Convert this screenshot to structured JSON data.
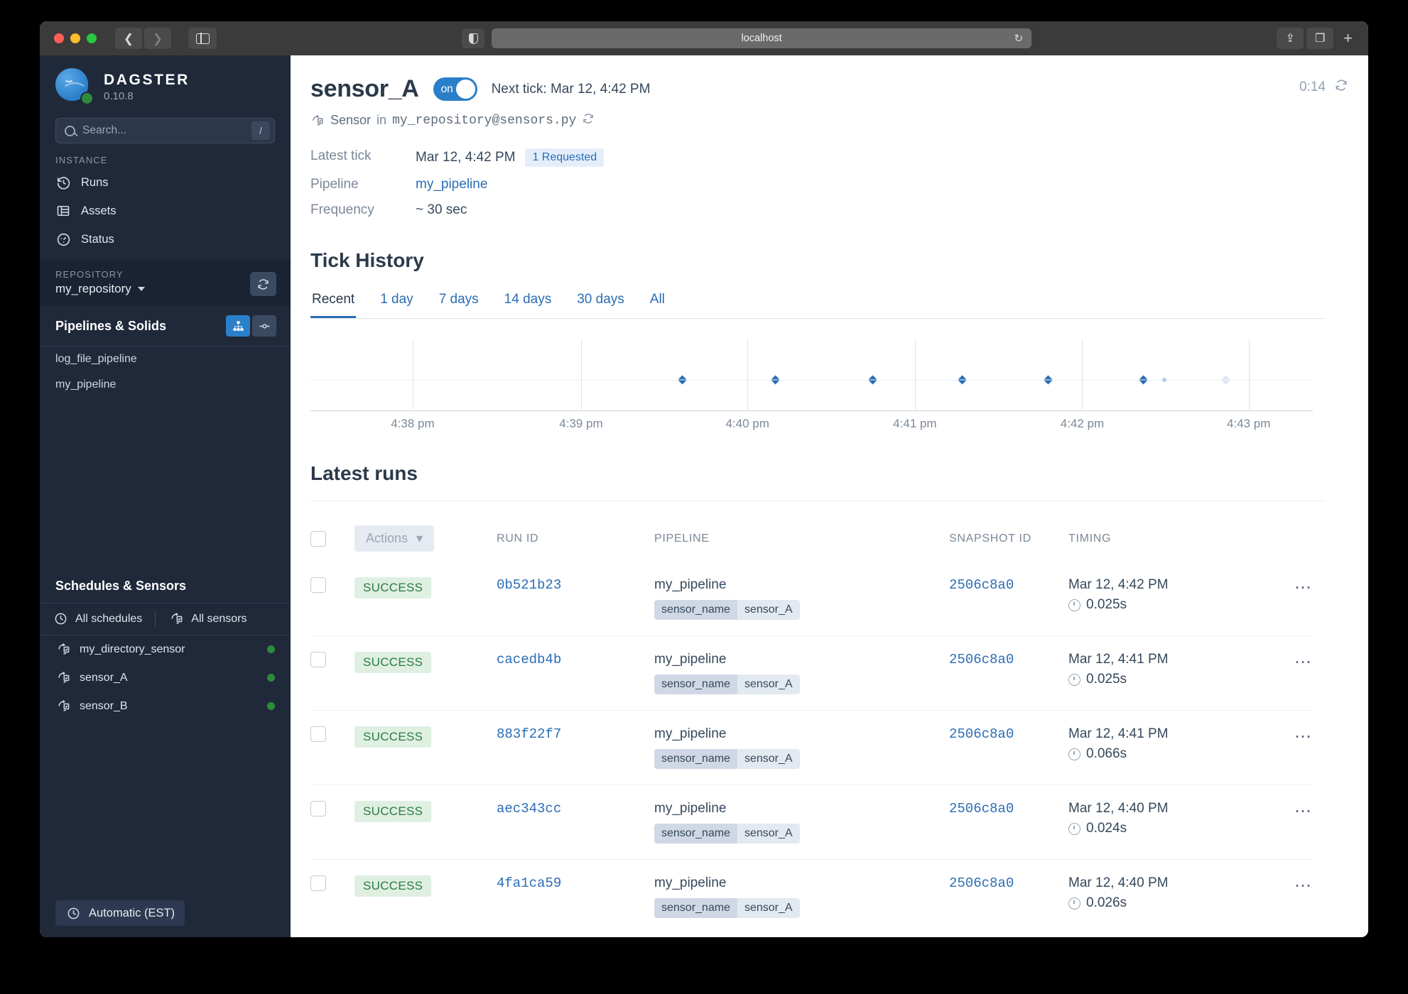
{
  "browser": {
    "url": "localhost",
    "back_icon": "chevron-left-icon",
    "forward_icon": "chevron-right-icon",
    "sidebar_icon": "sidebar-toggle-icon",
    "shield_icon": "reader-contrast-icon",
    "reload_icon": "reload-icon",
    "share_icon": "share-icon",
    "tabs_icon": "tab-overview-icon",
    "new_tab_icon": "plus-icon"
  },
  "sidebar": {
    "brand": {
      "name": "DAGSTER",
      "version": "0.10.8"
    },
    "search": {
      "placeholder": "Search...",
      "value": "",
      "shortcut": "/"
    },
    "instance_label": "INSTANCE",
    "instance_items": [
      {
        "label": "Runs",
        "icon": "history-icon"
      },
      {
        "label": "Assets",
        "icon": "table-icon"
      },
      {
        "label": "Status",
        "icon": "gauge-icon"
      }
    ],
    "repository": {
      "label": "REPOSITORY",
      "name": "my_repository",
      "refresh_icon": "refresh-icon"
    },
    "pipelines": {
      "title": "Pipelines & Solids",
      "items": [
        "log_file_pipeline",
        "my_pipeline"
      ]
    },
    "schedules": {
      "title": "Schedules & Sensors",
      "all_schedules": "All schedules",
      "all_sensors": "All sensors",
      "sensors": [
        {
          "name": "my_directory_sensor",
          "status": "on"
        },
        {
          "name": "sensor_A",
          "status": "on"
        },
        {
          "name": "sensor_B",
          "status": "on"
        }
      ]
    },
    "timezone_button": "Automatic (EST)"
  },
  "header": {
    "title": "sensor_A",
    "toggle_label": "on",
    "next_tick": "Next tick: Mar 12, 4:42 PM",
    "subline_prefix": "Sensor",
    "subline_in": "in",
    "subline_location": "my_repository@sensors.py",
    "refresh_timer": "0:14"
  },
  "details": [
    {
      "key": "Latest tick",
      "value": "Mar 12, 4:42 PM",
      "badge": "1 Requested"
    },
    {
      "key": "Pipeline",
      "value": "my_pipeline",
      "link": true
    },
    {
      "key": "Frequency",
      "value": "~ 30 sec"
    }
  ],
  "tick_history": {
    "title": "Tick History",
    "tabs": [
      "Recent",
      "1 day",
      "7 days",
      "14 days",
      "30 days",
      "All"
    ],
    "active_tab": "Recent"
  },
  "chart_data": {
    "type": "scatter",
    "title": "Tick History",
    "xlabel": "",
    "ylabel": "",
    "grid": true,
    "legend": "none",
    "tick_labels": [
      "4:38 pm",
      "4:39 pm",
      "4:40 pm",
      "4:41 pm",
      "4:42 pm",
      "4:43 pm"
    ],
    "tick_positions_pct": [
      10.2,
      27.0,
      43.6,
      60.3,
      77.0,
      93.6
    ],
    "points": [
      {
        "x_pct": 37.1,
        "status": "success"
      },
      {
        "x_pct": 46.4,
        "status": "success"
      },
      {
        "x_pct": 56.1,
        "status": "success"
      },
      {
        "x_pct": 65.0,
        "status": "success"
      },
      {
        "x_pct": 73.6,
        "status": "success"
      },
      {
        "x_pct": 83.1,
        "status": "success"
      },
      {
        "x_pct": 85.2,
        "status": "minor"
      },
      {
        "x_pct": 91.3,
        "status": "pending"
      }
    ]
  },
  "latest_runs": {
    "title": "Latest runs",
    "actions_label": "Actions",
    "columns": [
      "RUN ID",
      "PIPELINE",
      "SNAPSHOT ID",
      "TIMING"
    ],
    "rows": [
      {
        "status": "SUCCESS",
        "run_id": "0b521b23",
        "pipeline": "my_pipeline",
        "tag_key": "sensor_name",
        "tag_value": "sensor_A",
        "snapshot_id": "2506c8a0",
        "timestamp": "Mar 12, 4:42 PM",
        "duration": "0.025s"
      },
      {
        "status": "SUCCESS",
        "run_id": "cacedb4b",
        "pipeline": "my_pipeline",
        "tag_key": "sensor_name",
        "tag_value": "sensor_A",
        "snapshot_id": "2506c8a0",
        "timestamp": "Mar 12, 4:41 PM",
        "duration": "0.025s"
      },
      {
        "status": "SUCCESS",
        "run_id": "883f22f7",
        "pipeline": "my_pipeline",
        "tag_key": "sensor_name",
        "tag_value": "sensor_A",
        "snapshot_id": "2506c8a0",
        "timestamp": "Mar 12, 4:41 PM",
        "duration": "0.066s"
      },
      {
        "status": "SUCCESS",
        "run_id": "aec343cc",
        "pipeline": "my_pipeline",
        "tag_key": "sensor_name",
        "tag_value": "sensor_A",
        "snapshot_id": "2506c8a0",
        "timestamp": "Mar 12, 4:40 PM",
        "duration": "0.024s"
      },
      {
        "status": "SUCCESS",
        "run_id": "4fa1ca59",
        "pipeline": "my_pipeline",
        "tag_key": "sensor_name",
        "tag_value": "sensor_A",
        "snapshot_id": "2506c8a0",
        "timestamp": "Mar 12, 4:40 PM",
        "duration": "0.026s"
      }
    ]
  },
  "colors": {
    "accent": "#2a7fc9",
    "link": "#2a6db5",
    "success": "#2b7a42",
    "sidebar": "#20293a"
  }
}
